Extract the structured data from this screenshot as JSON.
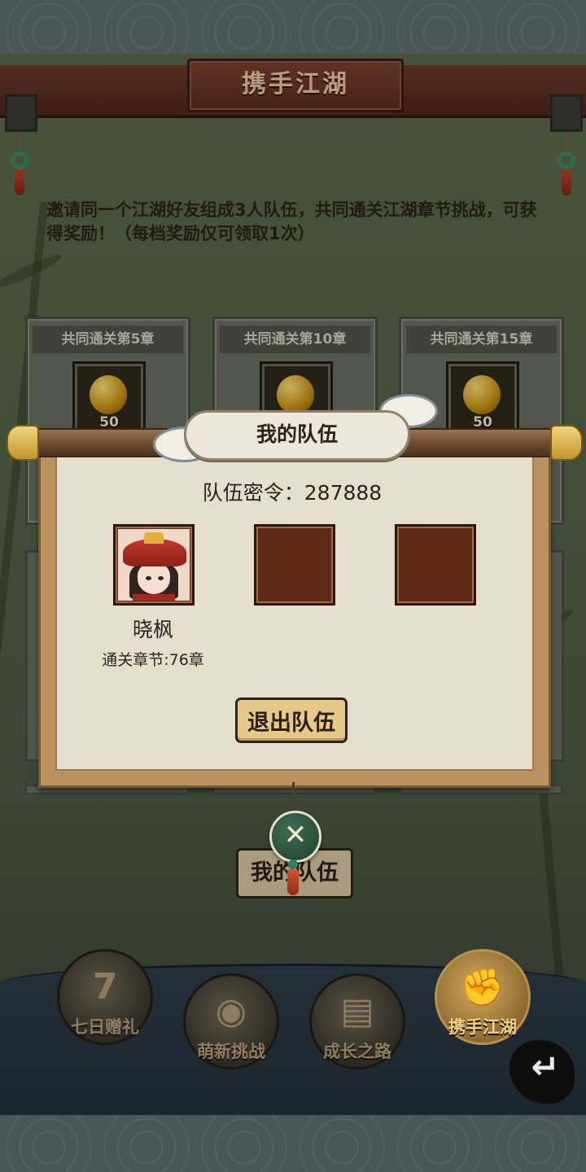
{
  "header": {
    "title": "携手江湖"
  },
  "intro": {
    "text": "邀请同一个江湖好友组成3人队伍，共同通关江湖章节挑战，可获得奖励！（每档奖励仅可领取1次）"
  },
  "reward_cards": [
    {
      "title": "共同通关第5章",
      "qty": "50",
      "icon": "gold-bell-icon"
    },
    {
      "title": "共同通关第10章",
      "qty": "50",
      "icon": "gold-bell-icon"
    },
    {
      "title": "共同通关第15章",
      "qty": "50",
      "icon": "gold-bell-icon"
    }
  ],
  "team_button": {
    "label": "我的队伍"
  },
  "modal": {
    "title": "我的队伍",
    "team_code": "队伍密令：287888",
    "members": [
      {
        "name": "晓枫",
        "progress": "通关章节:76章",
        "avatar": "avatar-girl-red-hat"
      }
    ],
    "empty_slots": 2,
    "quit_label": "退出队伍",
    "close_icon": "close-icon"
  },
  "bottom_nav": [
    {
      "label": "七日赠礼",
      "icon": "gift-box-icon",
      "glyph": "7",
      "active": false
    },
    {
      "label": "萌新挑战",
      "icon": "challenge-icon",
      "glyph": "◉",
      "active": false
    },
    {
      "label": "成长之路",
      "icon": "growth-book-icon",
      "glyph": "▤",
      "active": false
    },
    {
      "label": "携手江湖",
      "icon": "handshake-icon",
      "glyph": "✊",
      "active": true
    }
  ],
  "back_icon": "back-arrow-icon",
  "colors": {
    "accent_gold": "#e8c88a",
    "panel_bg": "#e4dece",
    "slot_brown": "#5e2a14"
  }
}
